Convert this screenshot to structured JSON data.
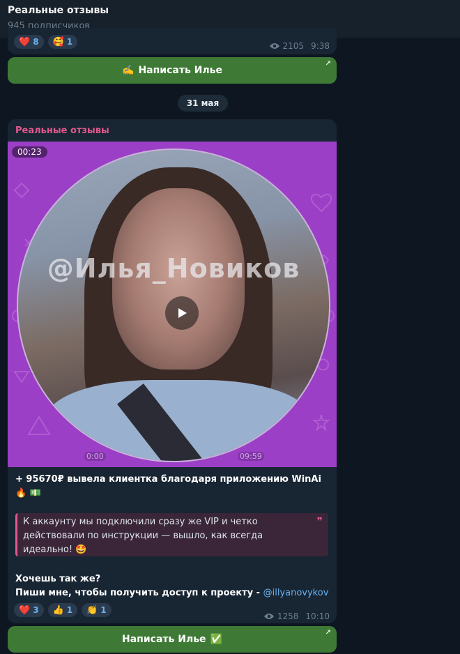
{
  "header": {
    "title": "Реальные отзывы",
    "subscribers": "945 подписчиков"
  },
  "post1": {
    "reactions": [
      {
        "emoji": "❤️",
        "count": "8"
      },
      {
        "emoji": "🥰",
        "count": "1"
      }
    ],
    "views": "2105",
    "time": "9:38",
    "button": {
      "icon": "✍️",
      "label": "Написать Илье"
    }
  },
  "date_separator": "31 мая",
  "post2": {
    "sender": "Реальные отзывы",
    "video": {
      "duration": "00:23",
      "watermark": "@Илья_Новиков",
      "start": "0:00",
      "end": "09:59"
    },
    "headline": "+ 95670₽ вывела клиентка благодаря приложению WinAi 🔥 💵",
    "quote": "К аккаунту мы подключили сразу же VIP и четко действовали по инструкции — вышло, как всегда идеально! 🤩",
    "line1": "Хочешь так же?",
    "line2_prefix": "Пиши мне, чтобы получить доступ к проекту - ",
    "link": "@illyanovykov",
    "reactions": [
      {
        "emoji": "❤️",
        "count": "3"
      },
      {
        "emoji": "👍",
        "count": "1"
      },
      {
        "emoji": "👏",
        "count": "1"
      }
    ],
    "views": "1258",
    "time": "10:10",
    "button": {
      "label": "Написать Илье",
      "icon": "✅"
    }
  },
  "colors": {
    "background": "#0e1621",
    "bubble": "#182533",
    "button": "#3e7a35",
    "accent": "#e3598d",
    "link": "#6ab3f3"
  }
}
